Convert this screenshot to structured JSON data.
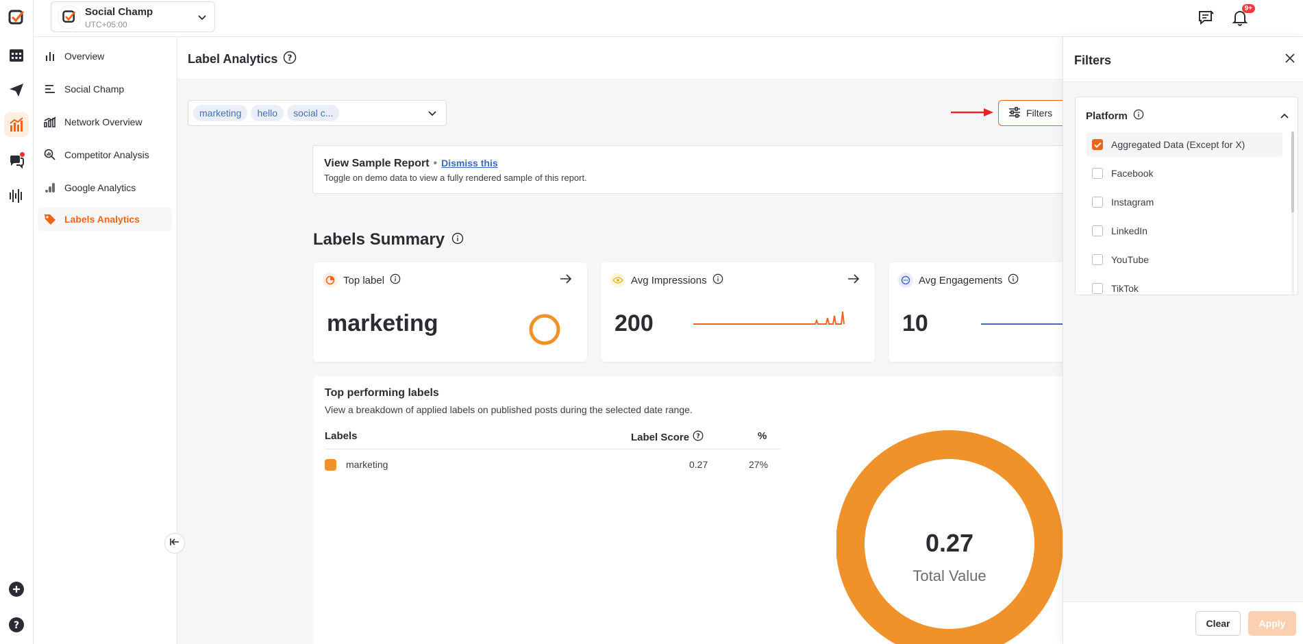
{
  "workspace": {
    "name": "Social Champ",
    "timezone": "UTC+05:00"
  },
  "topbar": {
    "notifications_badge": "9+"
  },
  "nav": {
    "items": [
      {
        "label": "Overview",
        "icon": "bar-chart-icon"
      },
      {
        "label": "Social Champ",
        "icon": "list-bars-icon"
      },
      {
        "label": "Network Overview",
        "icon": "network-chart-icon"
      },
      {
        "label": "Competitor Analysis",
        "icon": "magnify-chart-icon"
      },
      {
        "label": "Google Analytics",
        "icon": "google-analytics-icon"
      },
      {
        "label": "Labels Analytics",
        "icon": "tag-icon",
        "active": true
      }
    ]
  },
  "page": {
    "title": "Label Analytics"
  },
  "labels_filter": {
    "chips": [
      "marketing",
      "hello",
      "social c..."
    ]
  },
  "filters_button": {
    "label": "Filters"
  },
  "sample_report": {
    "title": "View Sample Report",
    "separator": "•",
    "dismiss": "Dismiss this",
    "description": "Toggle on demo data to view a fully rendered sample of this report."
  },
  "summary": {
    "title": "Labels Summary",
    "cards": [
      {
        "title": "Top label",
        "value": "marketing"
      },
      {
        "title": "Avg Impressions",
        "value": "200"
      },
      {
        "title": "Avg Engagements",
        "value": "10"
      }
    ]
  },
  "top_performing": {
    "title": "Top performing labels",
    "description": "View a breakdown of applied labels on published posts during the selected date range.",
    "columns": [
      "Labels",
      "Label Score",
      "%"
    ],
    "rows": [
      {
        "label": "marketing",
        "score": "0.27",
        "percent": "27%"
      }
    ],
    "donut": {
      "value": "0.27",
      "caption": "Total Value",
      "fraction": 1.0
    }
  },
  "filters_panel": {
    "title": "Filters",
    "section_title": "Platform",
    "options": [
      {
        "label": "Aggregated Data (Except for X)",
        "checked": true
      },
      {
        "label": "Facebook",
        "checked": false
      },
      {
        "label": "Instagram",
        "checked": false
      },
      {
        "label": "LinkedIn",
        "checked": false
      },
      {
        "label": "YouTube",
        "checked": false
      },
      {
        "label": "TikTok",
        "checked": false
      }
    ],
    "clear": "Clear",
    "apply": "Apply"
  },
  "colors": {
    "brand": "#f0631b",
    "donut": "#f0922a",
    "link": "#3a6ac0",
    "engagements": "#4a66c4"
  }
}
